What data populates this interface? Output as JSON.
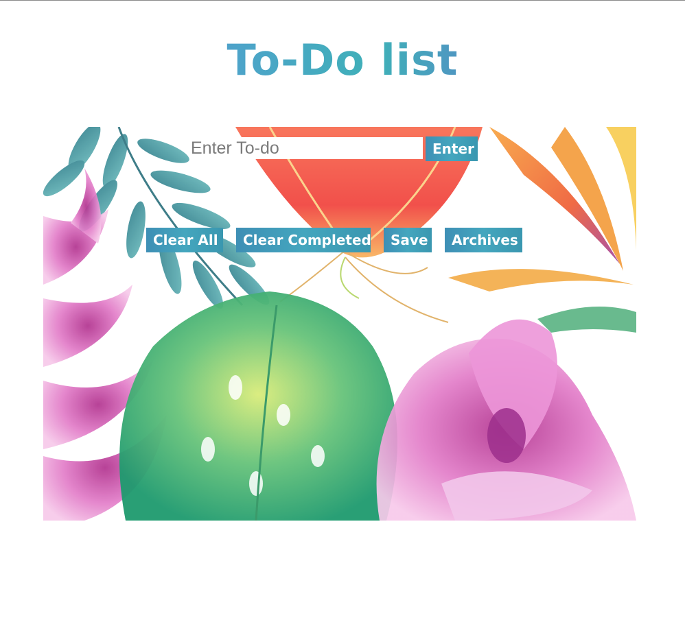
{
  "app": {
    "title": "To-Do list"
  },
  "input": {
    "placeholder": "Enter To-do",
    "value": ""
  },
  "buttons": {
    "enter": "Enter",
    "clear_all": "Clear All",
    "clear_completed": "Clear Completed",
    "save": "Save",
    "archives": "Archives"
  },
  "colors": {
    "title_gradient": [
      "#5b6fc6",
      "#4da4c9",
      "#3fb0b8"
    ],
    "button_bg": "#44a6be",
    "button_text": "#ffffff"
  },
  "background": {
    "image": "tropical watercolor flowers and leaves"
  }
}
